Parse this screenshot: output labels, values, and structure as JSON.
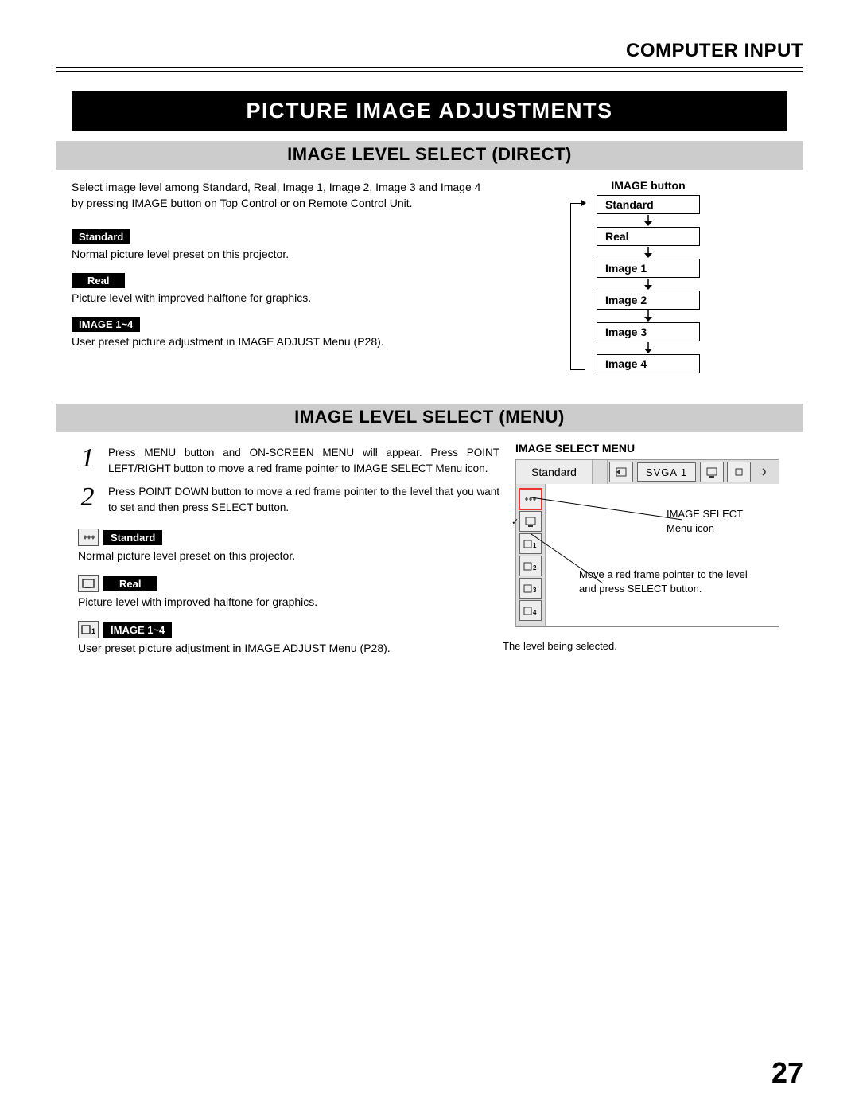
{
  "page": {
    "header": "COMPUTER INPUT",
    "title": "PICTURE IMAGE ADJUSTMENTS",
    "number": "27"
  },
  "direct": {
    "heading": "IMAGE LEVEL SELECT (DIRECT)",
    "intro": "Select image level among Standard, Real, Image 1, Image 2, Image 3 and Image 4 by pressing IMAGE button on Top Control or on Remote Control Unit.",
    "items": [
      {
        "label": "Standard",
        "desc": "Normal picture level preset on this projector."
      },
      {
        "label": "Real",
        "desc": "Picture level with improved halftone for graphics."
      },
      {
        "label": "IMAGE 1~4",
        "desc": "User preset picture adjustment in IMAGE ADJUST Menu (P28)."
      }
    ],
    "flow": {
      "title": "IMAGE button",
      "boxes": [
        "Standard",
        "Real",
        "Image 1",
        "Image 2",
        "Image 3",
        "Image 4"
      ]
    }
  },
  "menu": {
    "heading": "IMAGE LEVEL SELECT (MENU)",
    "steps": [
      "Press MENU button and ON-SCREEN MENU will appear.  Press POINT LEFT/RIGHT button to move a red frame pointer to IMAGE SELECT Menu icon.",
      "Press POINT DOWN button to move a red frame pointer to the level that you want to set and then press SELECT button."
    ],
    "items": [
      {
        "icon": "diamonds",
        "label": "Standard",
        "desc": "Normal picture level preset on this projector."
      },
      {
        "icon": "real",
        "label": "Real",
        "desc": "Picture level with improved halftone for graphics."
      },
      {
        "icon": "img1",
        "label": "IMAGE 1~4",
        "desc": "User preset picture adjustment in IMAGE ADJUST Menu (P28)."
      }
    ],
    "diagram": {
      "title": "IMAGE SELECT MENU",
      "display": "Standard",
      "svga": "SVGA 1",
      "callout1": "IMAGE SELECT Menu icon",
      "callout2": "Move a red frame pointer to the level and press SELECT button.",
      "callout3": "The level being selected."
    }
  }
}
